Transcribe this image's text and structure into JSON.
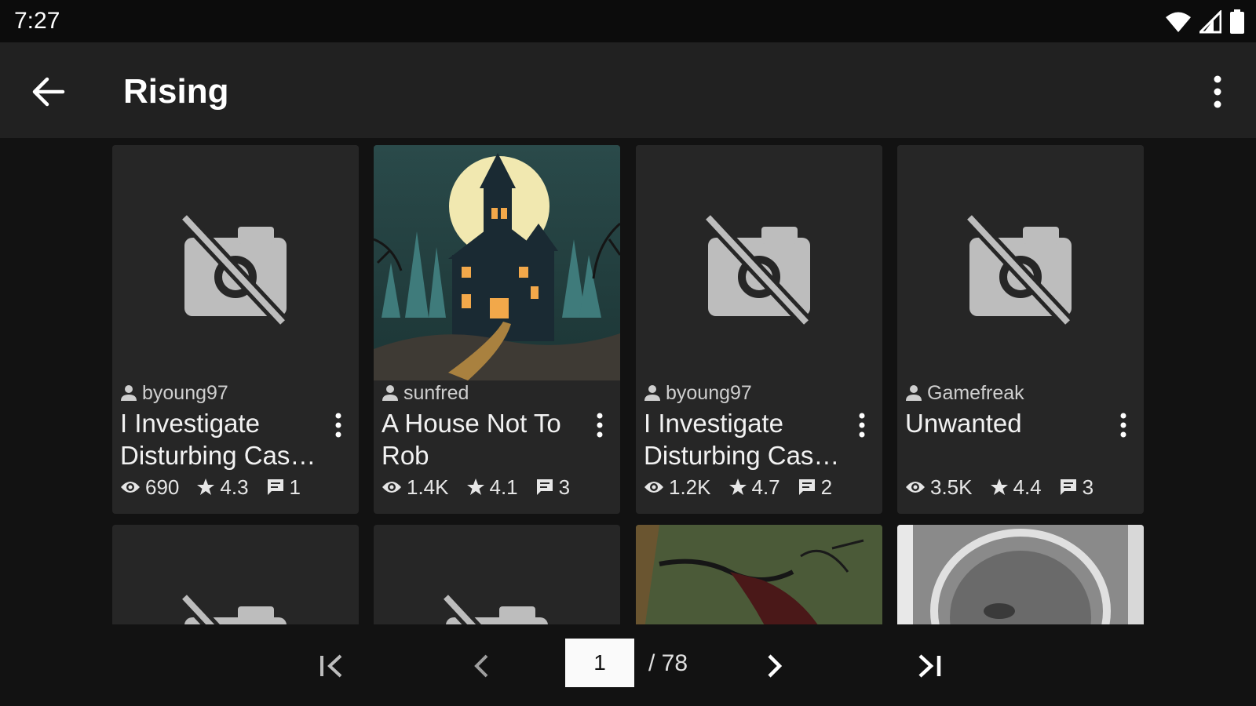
{
  "status": {
    "time": "7:27"
  },
  "appbar": {
    "title": "Rising"
  },
  "stories": [
    {
      "author": "byoung97",
      "title": "I Investigate Disturbing Cas…",
      "views": "690",
      "rating": "4.3",
      "comments": "1",
      "cover": "placeholder"
    },
    {
      "author": "sunfred",
      "title": "A House Not To Rob",
      "views": "1.4K",
      "rating": "4.1",
      "comments": "3",
      "cover": "haunted-house"
    },
    {
      "author": "byoung97",
      "title": "I Investigate Disturbing Cas…",
      "views": "1.2K",
      "rating": "4.7",
      "comments": "2",
      "cover": "placeholder"
    },
    {
      "author": "Gamefreak",
      "title": "Unwanted",
      "views": "3.5K",
      "rating": "4.4",
      "comments": "3",
      "cover": "placeholder"
    }
  ],
  "pager": {
    "current": "1",
    "total": "/ 78"
  },
  "colors": {
    "background": "#121212",
    "card": "#262626",
    "appbar": "#212121",
    "icon": "#bdbdbd"
  }
}
